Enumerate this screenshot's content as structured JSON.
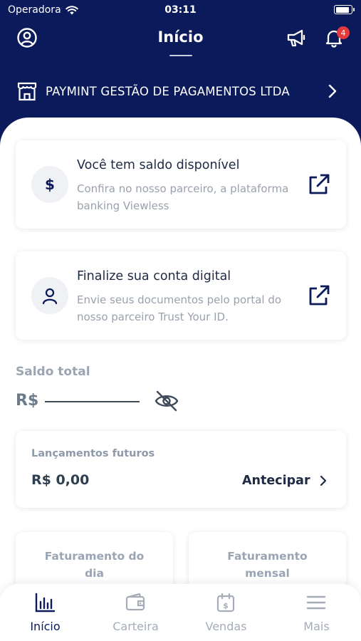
{
  "status_bar": {
    "carrier": "Operadora",
    "time": "03:11",
    "battery_level": 0.9
  },
  "header": {
    "title": "Início",
    "notification_count": "4"
  },
  "company": {
    "name": "PAYMINT GESTÃO DE PAGAMENTOS LTDA"
  },
  "cards": {
    "balance": {
      "title": "Você tem saldo disponível",
      "description": "Confira no nosso parceiro, a plataforma banking Viewless",
      "icon_symbol": "$"
    },
    "account": {
      "title": "Finalize sua conta digital",
      "description": "Envie seus documentos pelo portal do nosso parceiro Trust Your ID."
    }
  },
  "saldo": {
    "label": "Saldo total",
    "currency": "R$"
  },
  "future": {
    "label": "Lançamentos futuros",
    "value": "R$ 0,00",
    "action_label": "Antecipar"
  },
  "stats": {
    "daily_label": "Faturamento do dia",
    "monthly_label": "Faturamento mensal"
  },
  "tabs": [
    {
      "label": "Início",
      "icon": "bar-chart-icon",
      "active": true
    },
    {
      "label": "Carteira",
      "icon": "wallet-icon",
      "active": false
    },
    {
      "label": "Vendas",
      "icon": "calendar-dollar-icon",
      "active": false
    },
    {
      "label": "Mais",
      "icon": "menu-icon",
      "active": false
    }
  ],
  "colors": {
    "brand": "#0b1a5a",
    "badge": "#e23b3b",
    "muted": "#9aa5b4"
  }
}
